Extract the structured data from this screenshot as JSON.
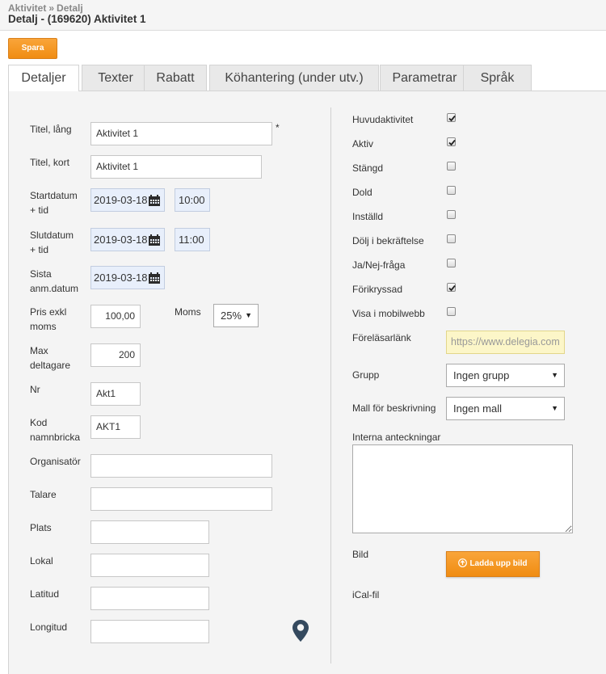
{
  "header": {
    "breadcrumb": [
      "Aktivitet",
      "Detalj"
    ],
    "breadcrumb_sep": "»",
    "title": "Detalj - (169620) Aktivitet 1"
  },
  "toolbar": {
    "save_label": "Spara"
  },
  "tabs": [
    {
      "label": "Detaljer",
      "active": true
    },
    {
      "label": "Texter",
      "active": false
    },
    {
      "label": "Rabatt",
      "active": false
    },
    {
      "label": "Köhantering (under utv.)",
      "active": false
    },
    {
      "label": "Parametrar",
      "active": false
    },
    {
      "label": "Språk",
      "active": false
    }
  ],
  "left": {
    "titel_lang": {
      "label": "Titel, lång",
      "value": "Aktivitet 1",
      "required_mark": "*"
    },
    "titel_kort": {
      "label": "Titel, kort",
      "value": "Aktivitet 1"
    },
    "startdatum": {
      "label_1": "Startdatum",
      "label_2": "+ tid",
      "date": "2019-03-18",
      "time": "10:00"
    },
    "slutdatum": {
      "label_1": "Slutdatum",
      "label_2": "+ tid",
      "date": "2019-03-18",
      "time": "11:00"
    },
    "sista_anm": {
      "label_1": "Sista",
      "label_2": "anm.datum",
      "date": "2019-03-18"
    },
    "pris": {
      "label_1": "Pris exkl",
      "label_2": "moms",
      "value": "100,00"
    },
    "moms": {
      "label": "Moms",
      "value": "25%"
    },
    "max_deltagare": {
      "label_1": "Max",
      "label_2": "deltagare",
      "value": "200"
    },
    "nr": {
      "label": "Nr",
      "value": "Akt1"
    },
    "kod": {
      "label_1": "Kod",
      "label_2": "namnbricka",
      "value": "AKT1"
    },
    "organisator": {
      "label": "Organisatör",
      "value": ""
    },
    "talare": {
      "label": "Talare",
      "value": ""
    },
    "plats": {
      "label": "Plats",
      "value": ""
    },
    "lokal": {
      "label": "Lokal",
      "value": ""
    },
    "latitud": {
      "label": "Latitud",
      "value": ""
    },
    "longitud": {
      "label": "Longitud",
      "value": ""
    }
  },
  "right": {
    "checkboxes": [
      {
        "label": "Huvudaktivitet",
        "checked": true
      },
      {
        "label": "Aktiv",
        "checked": true
      },
      {
        "label": "Stängd",
        "checked": false
      },
      {
        "label": "Dold",
        "checked": false
      },
      {
        "label": "Inställd",
        "checked": false
      },
      {
        "label": "Dölj i bekräftelse",
        "checked": false
      },
      {
        "label": "Ja/Nej-fråga",
        "checked": false
      },
      {
        "label": "Förikryssad",
        "checked": true
      },
      {
        "label": "Visa i mobilwebb",
        "checked": false
      }
    ],
    "forelasarlank": {
      "label": "Föreläsarlänk",
      "placeholder": "https://www.delegia.com"
    },
    "grupp": {
      "label": "Grupp",
      "value": "Ingen grupp"
    },
    "mall": {
      "label": "Mall för beskrivning",
      "value": "Ingen mall"
    },
    "anteckningar": {
      "label": "Interna anteckningar",
      "value": ""
    },
    "bild": {
      "label": "Bild",
      "button": "Ladda upp bild"
    },
    "ical": {
      "label": "iCal-fil"
    }
  },
  "colors": {
    "accent_orange": "#f39c1f",
    "date_field_bg": "#e8effb",
    "link_field_bg": "#fcf6c8",
    "panel_bg": "#f4f4f4",
    "pin_color": "#34495e"
  },
  "icons": {
    "calendar": "calendar-icon",
    "caret": "caret-down-icon",
    "checkmark": "checkmark-icon",
    "upload": "upload-circle-icon",
    "map_pin": "map-pin-icon"
  }
}
